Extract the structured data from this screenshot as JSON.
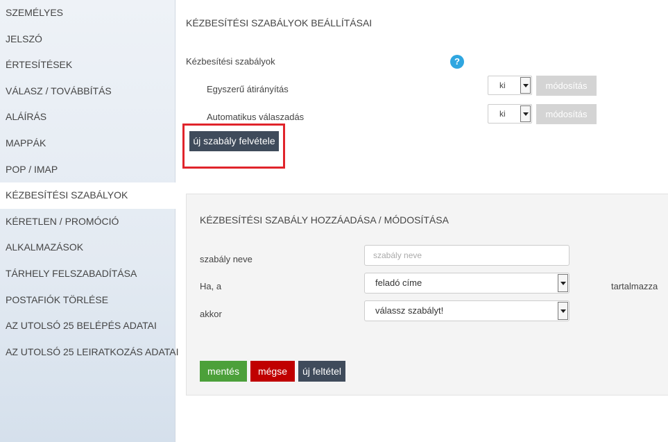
{
  "sidebar": {
    "items": [
      {
        "label": "SZEMÉLYES"
      },
      {
        "label": "JELSZÓ"
      },
      {
        "label": "ÉRTESÍTÉSEK"
      },
      {
        "label": "VÁLASZ / TOVÁBBÍTÁS"
      },
      {
        "label": "ALÁÍRÁS"
      },
      {
        "label": "MAPPÁK"
      },
      {
        "label": "POP / IMAP"
      },
      {
        "label": "KÉZBESÍTÉSI SZABÁLYOK"
      },
      {
        "label": "KÉRETLEN / PROMÓCIÓ"
      },
      {
        "label": "ALKALMAZÁSOK"
      },
      {
        "label": "TÁRHELY FELSZABADÍTÁSA"
      },
      {
        "label": "POSTAFIÓK TÖRLÉSE"
      },
      {
        "label": "AZ UTOLSÓ 25 BELÉPÉS ADATAI"
      },
      {
        "label": "AZ UTOLSÓ 25 LEIRATKOZÁS ADATAI"
      }
    ],
    "active_index": 7
  },
  "main": {
    "title": "KÉZBESÍTÉSI SZABÁLYOK BEÁLLÍTÁSAI",
    "rules_label": "Kézbesítési szabályok",
    "help_icon": "?",
    "rules": [
      {
        "label": "Egyszerű átirányítás",
        "value": "ki",
        "modify_label": "módosítás"
      },
      {
        "label": "Automatikus válaszadás",
        "value": "ki",
        "modify_label": "módosítás"
      }
    ],
    "new_rule_button": "új szabály felvétele"
  },
  "panel": {
    "title": "KÉZBESÍTÉSI SZABÁLY HOZZÁADÁSA / MÓDOSÍTÁSA",
    "name_label": "szabály neve",
    "name_placeholder": "szabály neve",
    "if_label": "Ha, a",
    "if_value": "feladó címe",
    "contains_label": "tartalmazza",
    "then_label": "akkor",
    "then_value": "válassz szabályt!",
    "save_button": "mentés",
    "cancel_button": "mégse",
    "new_condition_button": "új feltétel"
  },
  "colors": {
    "accent_blue": "#2fa6e0",
    "dark_button": "#3f4b5b",
    "save_green": "#4ca03a",
    "cancel_red": "#c00000",
    "highlight_red": "#e0242b",
    "disabled_gray": "#d4d4d4"
  }
}
